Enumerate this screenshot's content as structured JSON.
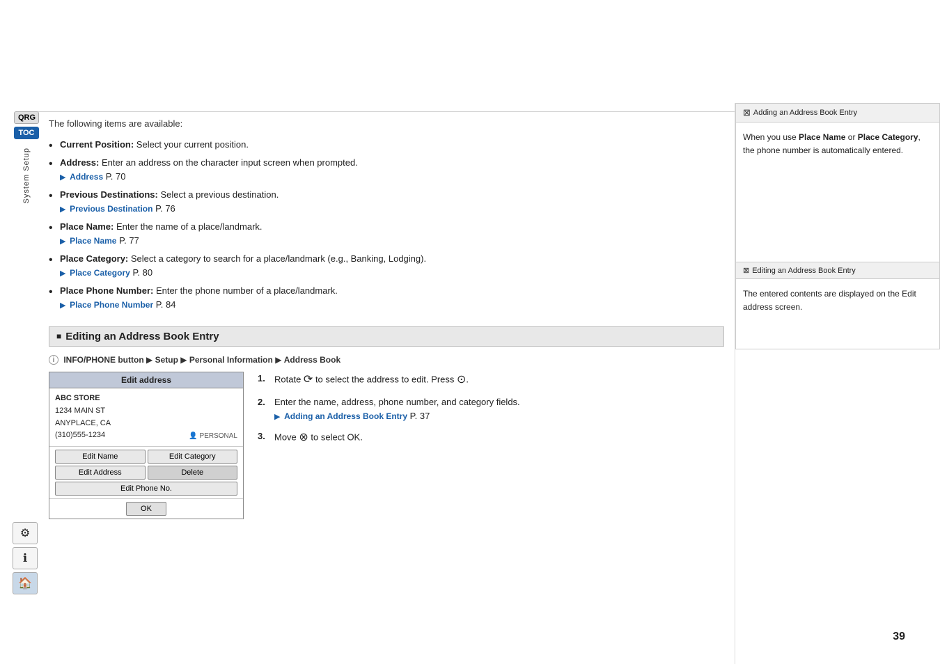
{
  "breadcrumb": {
    "sep1": "▶▶",
    "item1": "Personal Information",
    "sep2": "▶",
    "item2": "Address Book"
  },
  "sidebar": {
    "qrg_label": "QRG",
    "toc_label": "TOC",
    "system_setup_label": "System Setup"
  },
  "main": {
    "intro": "The following items are available:",
    "bullets": [
      {
        "id": "current-position",
        "title": "Current Position:",
        "text": " Select your current position.",
        "link": null
      },
      {
        "id": "address",
        "title": "Address:",
        "text": " Enter an address on the character input screen when prompted.",
        "link_text": "Address",
        "link_page": "P. 70"
      },
      {
        "id": "previous-destinations",
        "title": "Previous Destinations:",
        "text": " Select a previous destination.",
        "link_text": "Previous Destination",
        "link_page": "P. 76"
      },
      {
        "id": "place-name",
        "title": "Place Name:",
        "text": " Enter the name of a place/landmark.",
        "link_text": "Place Name",
        "link_page": "P. 77"
      },
      {
        "id": "place-category",
        "title": "Place Category:",
        "text": " Select a category to search for a place/landmark (e.g., Banking, Lodging).",
        "link_text": "Place Category",
        "link_page": "P. 80"
      },
      {
        "id": "place-phone-number",
        "title": "Place Phone Number:",
        "text": " Enter the phone number of a place/landmark.",
        "link_text": "Place Phone Number",
        "link_page": "P. 84"
      }
    ],
    "section_title": "Editing an Address Book Entry",
    "sub_heading": "INFO/PHONE button ▶ Setup ▶ Personal Information ▶ Address Book",
    "edit_address_ui": {
      "title": "Edit address",
      "store_name": "ABC STORE",
      "address_line1": "1234 MAIN ST",
      "address_line2": "ANYPLACE, CA",
      "phone": "(310)555-1234",
      "badge": "PERSONAL",
      "buttons": [
        {
          "label": "Edit Name",
          "col": 1
        },
        {
          "label": "Edit Category",
          "col": 2
        },
        {
          "label": "Edit Address",
          "col": 1
        },
        {
          "label": "Delete",
          "col": 2
        },
        {
          "label": "Edit Phone No.",
          "col": "full"
        }
      ],
      "ok_label": "OK"
    },
    "steps": [
      {
        "num": "1.",
        "text": "Rotate  to select the address to edit. Press "
      },
      {
        "num": "2.",
        "text": "Enter the name, address, phone number, and category fields.",
        "link_text": "Adding an Address Book Entry",
        "link_page": "P. 37"
      },
      {
        "num": "3.",
        "text": "Move  to select OK."
      }
    ]
  },
  "right_panel": {
    "note1": {
      "header": "Adding an Address Book Entry",
      "body": "When you use Place Name or Place Category, the phone number is automatically entered."
    },
    "note2": {
      "header": "Editing an Address Book Entry",
      "body": "The entered contents are displayed on the Edit address screen."
    }
  },
  "page_number": "39"
}
